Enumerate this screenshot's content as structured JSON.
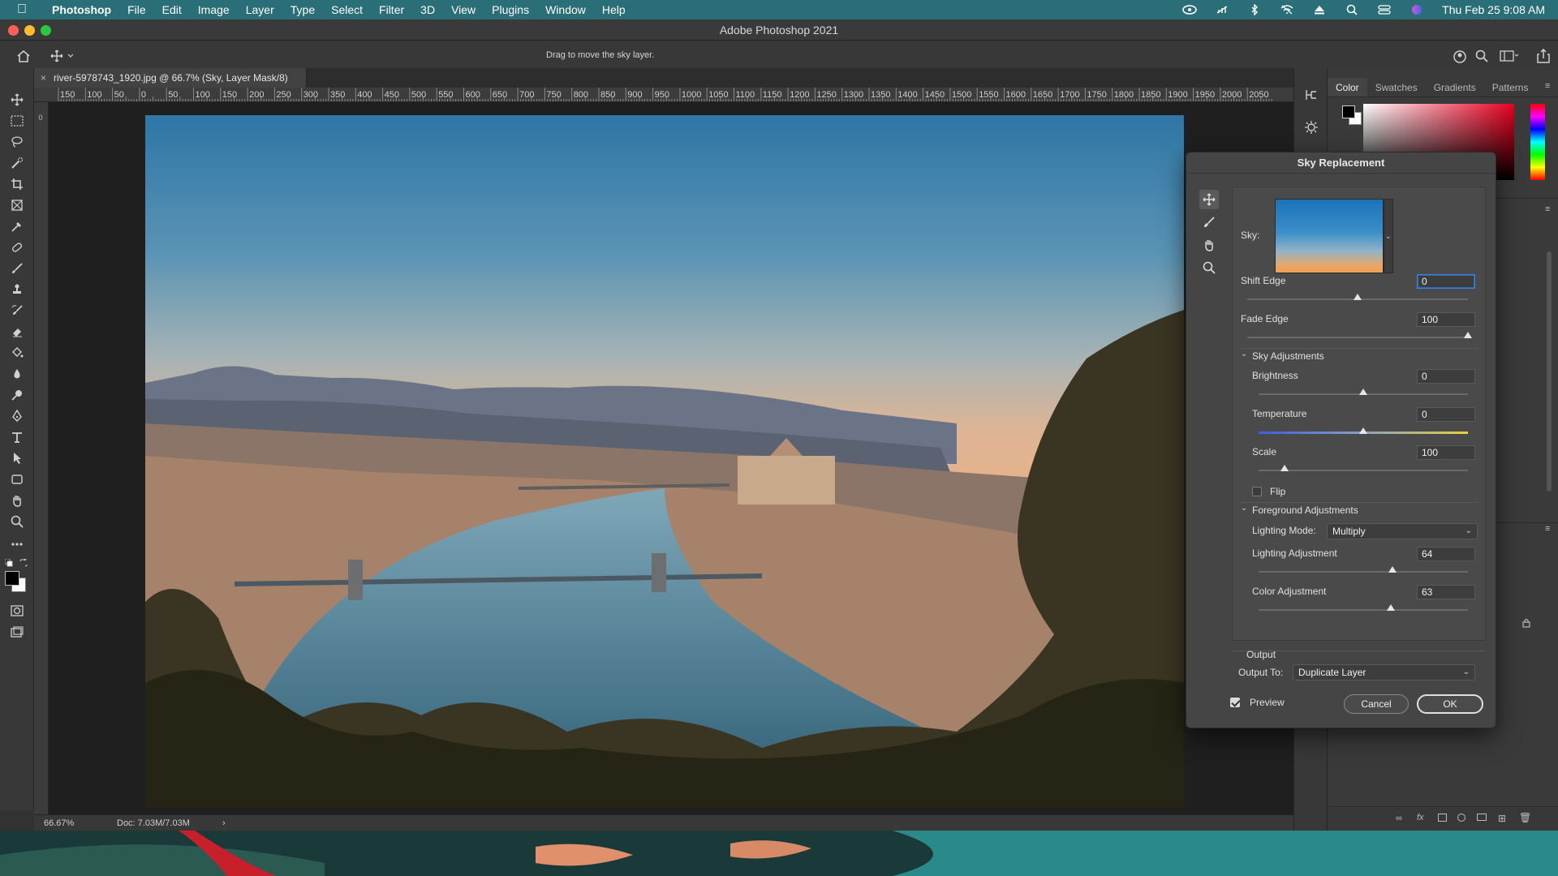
{
  "menubar": {
    "app": "Photoshop",
    "items": [
      "File",
      "Edit",
      "Image",
      "Layer",
      "Type",
      "Select",
      "Filter",
      "3D",
      "View",
      "Plugins",
      "Window",
      "Help"
    ],
    "datetime": "Thu Feb 25  9:08 AM"
  },
  "window": {
    "title": "Adobe Photoshop 2021",
    "options_hint": "Drag to move the sky layer."
  },
  "document": {
    "tab_title": "river-5978743_1920.jpg @ 66.7% (Sky, Layer Mask/8)",
    "zoom": "66.67%",
    "doc_info": "Doc: 7.03M/7.03M"
  },
  "ruler": {
    "top": [
      "150",
      "100",
      "50",
      "0",
      "50",
      "100",
      "150",
      "200",
      "250",
      "300",
      "350",
      "400",
      "450",
      "500",
      "550",
      "600",
      "650",
      "700",
      "750",
      "800",
      "850",
      "900",
      "950",
      "1000",
      "1050",
      "1100",
      "1150",
      "1200",
      "1250",
      "1300",
      "1350",
      "1400",
      "1450",
      "1500",
      "1550",
      "1600",
      "1650",
      "1700",
      "1750",
      "1800",
      "1850",
      "1900",
      "1950",
      "2000",
      "2050"
    ],
    "left_first": "0"
  },
  "panels": {
    "tabs": [
      "Color",
      "Swatches",
      "Gradients",
      "Patterns"
    ],
    "active_tab": "Color"
  },
  "dialog": {
    "title": "Sky Replacement",
    "sky_label": "Sky:",
    "shift_edge": {
      "label": "Shift Edge",
      "value": "0",
      "fraction": 0.5
    },
    "fade_edge": {
      "label": "Fade Edge",
      "value": "100",
      "fraction": 1.0
    },
    "sky_adjustments": {
      "header": "Sky Adjustments",
      "brightness": {
        "label": "Brightness",
        "value": "0",
        "fraction": 0.5
      },
      "temperature": {
        "label": "Temperature",
        "value": "0",
        "fraction": 0.5
      },
      "scale": {
        "label": "Scale",
        "value": "100",
        "fraction": 0.125
      },
      "flip_label": "Flip",
      "flip_checked": false
    },
    "foreground_adjustments": {
      "header": "Foreground Adjustments",
      "lighting_mode_label": "Lighting Mode:",
      "lighting_mode_value": "Multiply",
      "lighting_adjustment": {
        "label": "Lighting Adjustment",
        "value": "64",
        "fraction": 0.64
      },
      "color_adjustment": {
        "label": "Color Adjustment",
        "value": "63",
        "fraction": 0.63
      }
    },
    "output": {
      "header": "Output",
      "output_to_label": "Output To:",
      "output_to_value": "Duplicate Layer"
    },
    "preview_label": "Preview",
    "preview_checked": true,
    "cancel_label": "Cancel",
    "ok_label": "OK"
  },
  "colors": {
    "menubar_bg": "#2a6f78",
    "accent_blue": "#3c82d8",
    "foreground_swatch": "#000000",
    "background_swatch": "#ffffff"
  }
}
